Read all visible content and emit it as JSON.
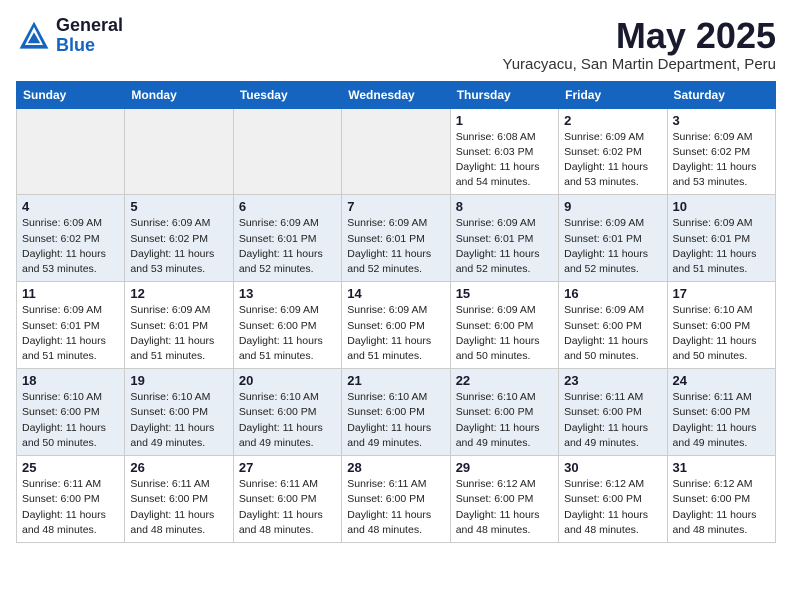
{
  "header": {
    "logo_general": "General",
    "logo_blue": "Blue",
    "month_title": "May 2025",
    "location": "Yuracyacu, San Martin Department, Peru"
  },
  "weekdays": [
    "Sunday",
    "Monday",
    "Tuesday",
    "Wednesday",
    "Thursday",
    "Friday",
    "Saturday"
  ],
  "weeks": [
    [
      {
        "day": "",
        "info": ""
      },
      {
        "day": "",
        "info": ""
      },
      {
        "day": "",
        "info": ""
      },
      {
        "day": "",
        "info": ""
      },
      {
        "day": "1",
        "info": "Sunrise: 6:08 AM\nSunset: 6:03 PM\nDaylight: 11 hours\nand 54 minutes."
      },
      {
        "day": "2",
        "info": "Sunrise: 6:09 AM\nSunset: 6:02 PM\nDaylight: 11 hours\nand 53 minutes."
      },
      {
        "day": "3",
        "info": "Sunrise: 6:09 AM\nSunset: 6:02 PM\nDaylight: 11 hours\nand 53 minutes."
      }
    ],
    [
      {
        "day": "4",
        "info": "Sunrise: 6:09 AM\nSunset: 6:02 PM\nDaylight: 11 hours\nand 53 minutes."
      },
      {
        "day": "5",
        "info": "Sunrise: 6:09 AM\nSunset: 6:02 PM\nDaylight: 11 hours\nand 53 minutes."
      },
      {
        "day": "6",
        "info": "Sunrise: 6:09 AM\nSunset: 6:01 PM\nDaylight: 11 hours\nand 52 minutes."
      },
      {
        "day": "7",
        "info": "Sunrise: 6:09 AM\nSunset: 6:01 PM\nDaylight: 11 hours\nand 52 minutes."
      },
      {
        "day": "8",
        "info": "Sunrise: 6:09 AM\nSunset: 6:01 PM\nDaylight: 11 hours\nand 52 minutes."
      },
      {
        "day": "9",
        "info": "Sunrise: 6:09 AM\nSunset: 6:01 PM\nDaylight: 11 hours\nand 52 minutes."
      },
      {
        "day": "10",
        "info": "Sunrise: 6:09 AM\nSunset: 6:01 PM\nDaylight: 11 hours\nand 51 minutes."
      }
    ],
    [
      {
        "day": "11",
        "info": "Sunrise: 6:09 AM\nSunset: 6:01 PM\nDaylight: 11 hours\nand 51 minutes."
      },
      {
        "day": "12",
        "info": "Sunrise: 6:09 AM\nSunset: 6:01 PM\nDaylight: 11 hours\nand 51 minutes."
      },
      {
        "day": "13",
        "info": "Sunrise: 6:09 AM\nSunset: 6:00 PM\nDaylight: 11 hours\nand 51 minutes."
      },
      {
        "day": "14",
        "info": "Sunrise: 6:09 AM\nSunset: 6:00 PM\nDaylight: 11 hours\nand 51 minutes."
      },
      {
        "day": "15",
        "info": "Sunrise: 6:09 AM\nSunset: 6:00 PM\nDaylight: 11 hours\nand 50 minutes."
      },
      {
        "day": "16",
        "info": "Sunrise: 6:09 AM\nSunset: 6:00 PM\nDaylight: 11 hours\nand 50 minutes."
      },
      {
        "day": "17",
        "info": "Sunrise: 6:10 AM\nSunset: 6:00 PM\nDaylight: 11 hours\nand 50 minutes."
      }
    ],
    [
      {
        "day": "18",
        "info": "Sunrise: 6:10 AM\nSunset: 6:00 PM\nDaylight: 11 hours\nand 50 minutes."
      },
      {
        "day": "19",
        "info": "Sunrise: 6:10 AM\nSunset: 6:00 PM\nDaylight: 11 hours\nand 49 minutes."
      },
      {
        "day": "20",
        "info": "Sunrise: 6:10 AM\nSunset: 6:00 PM\nDaylight: 11 hours\nand 49 minutes."
      },
      {
        "day": "21",
        "info": "Sunrise: 6:10 AM\nSunset: 6:00 PM\nDaylight: 11 hours\nand 49 minutes."
      },
      {
        "day": "22",
        "info": "Sunrise: 6:10 AM\nSunset: 6:00 PM\nDaylight: 11 hours\nand 49 minutes."
      },
      {
        "day": "23",
        "info": "Sunrise: 6:11 AM\nSunset: 6:00 PM\nDaylight: 11 hours\nand 49 minutes."
      },
      {
        "day": "24",
        "info": "Sunrise: 6:11 AM\nSunset: 6:00 PM\nDaylight: 11 hours\nand 49 minutes."
      }
    ],
    [
      {
        "day": "25",
        "info": "Sunrise: 6:11 AM\nSunset: 6:00 PM\nDaylight: 11 hours\nand 48 minutes."
      },
      {
        "day": "26",
        "info": "Sunrise: 6:11 AM\nSunset: 6:00 PM\nDaylight: 11 hours\nand 48 minutes."
      },
      {
        "day": "27",
        "info": "Sunrise: 6:11 AM\nSunset: 6:00 PM\nDaylight: 11 hours\nand 48 minutes."
      },
      {
        "day": "28",
        "info": "Sunrise: 6:11 AM\nSunset: 6:00 PM\nDaylight: 11 hours\nand 48 minutes."
      },
      {
        "day": "29",
        "info": "Sunrise: 6:12 AM\nSunset: 6:00 PM\nDaylight: 11 hours\nand 48 minutes."
      },
      {
        "day": "30",
        "info": "Sunrise: 6:12 AM\nSunset: 6:00 PM\nDaylight: 11 hours\nand 48 minutes."
      },
      {
        "day": "31",
        "info": "Sunrise: 6:12 AM\nSunset: 6:00 PM\nDaylight: 11 hours\nand 48 minutes."
      }
    ]
  ]
}
